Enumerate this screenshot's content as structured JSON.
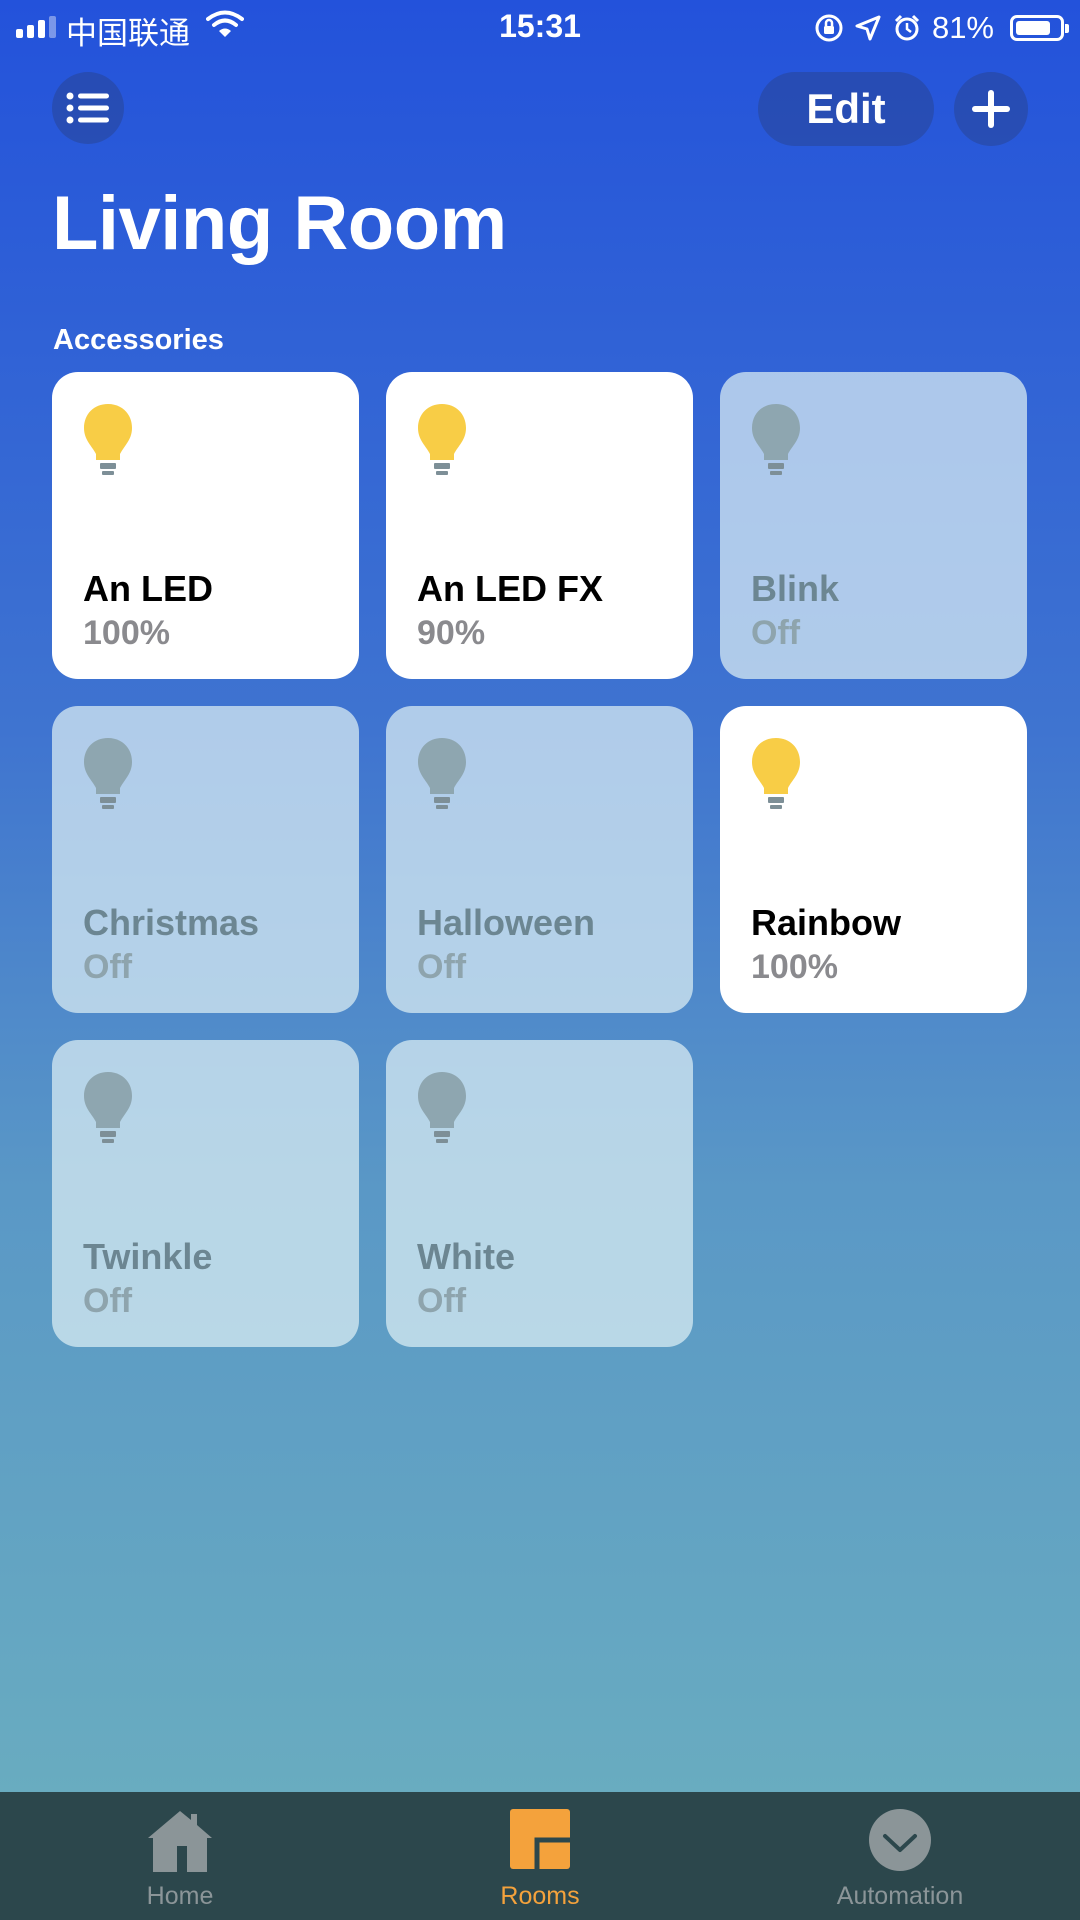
{
  "status_bar": {
    "carrier": "中国联通",
    "time": "15:31",
    "battery_percent": "81%",
    "battery_level": 0.81
  },
  "header": {
    "edit_label": "Edit",
    "title": "Living Room",
    "section_label": "Accessories"
  },
  "accessories": [
    {
      "name": "An LED",
      "state": "100%",
      "on": true
    },
    {
      "name": "An LED FX",
      "state": "90%",
      "on": true
    },
    {
      "name": "Blink",
      "state": "Off",
      "on": false
    },
    {
      "name": "Christmas",
      "state": "Off",
      "on": false
    },
    {
      "name": "Halloween",
      "state": "Off",
      "on": false
    },
    {
      "name": "Rainbow",
      "state": "100%",
      "on": true
    },
    {
      "name": "Twinkle",
      "state": "Off",
      "on": false
    },
    {
      "name": "White",
      "state": "Off",
      "on": false
    }
  ],
  "tabbar": {
    "tabs": [
      {
        "label": "Home",
        "icon": "home-icon"
      },
      {
        "label": "Rooms",
        "icon": "rooms-icon"
      },
      {
        "label": "Automation",
        "icon": "automation-icon"
      }
    ],
    "active": "Rooms"
  },
  "colors": {
    "bulb_on": "#f8cd46",
    "bulb_off": "#8ea6b0",
    "accent": "#f4a23c"
  }
}
